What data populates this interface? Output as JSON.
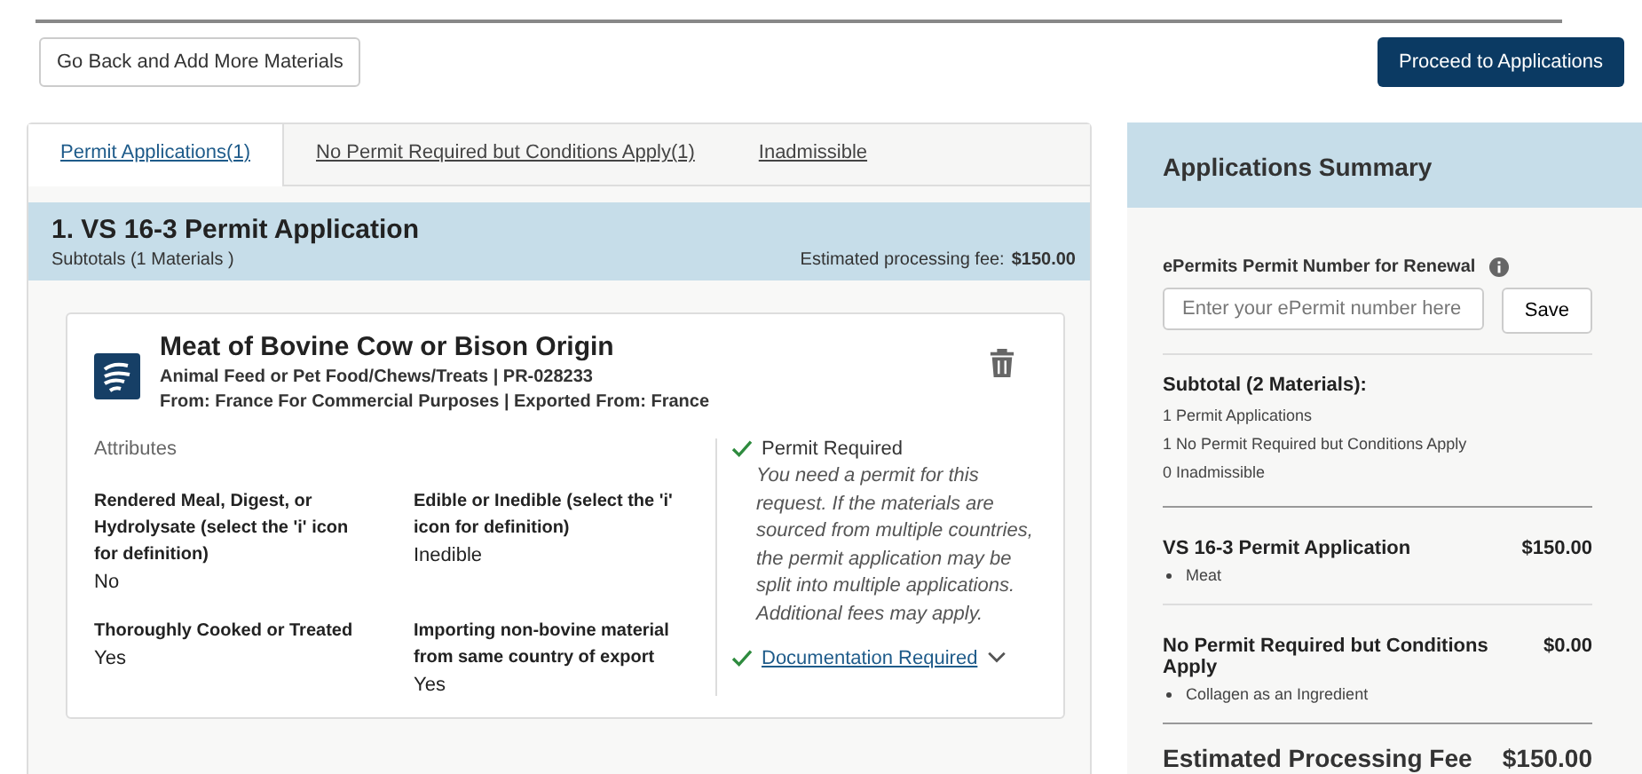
{
  "top_bar": {
    "back_button": "Go Back and Add More Materials",
    "proceed_button": "Proceed to Applications"
  },
  "tabs": [
    {
      "label": "Permit Applications(1)",
      "selected": true
    },
    {
      "label": "No Permit Required but Conditions Apply(1)",
      "selected": false
    },
    {
      "label": "Inadmissible",
      "selected": false
    }
  ],
  "application": {
    "title": "1. VS 16-3 Permit Application",
    "subtotals": "Subtotals (1 Materials )",
    "fee_label": "Estimated processing fee:",
    "fee": "$150.00"
  },
  "material": {
    "name": "Meat of Bovine Cow or Bison Origin",
    "category": "Animal Feed or Pet Food/Chews/Treats | PR-028233",
    "origin": "From: France For Commercial Purposes | Exported From: France",
    "attributes_heading": "Attributes",
    "attributes": [
      {
        "label": "Rendered Meal, Digest, or Hydrolysate (select the 'i' icon for definition)",
        "value": "No"
      },
      {
        "label": "Edible or Inedible (select the 'i' icon for definition)",
        "value": "Inedible"
      },
      {
        "label": "Thoroughly Cooked or Treated",
        "value": "Yes"
      },
      {
        "label": "Importing non-bovine material from same country of export",
        "value": "Yes"
      }
    ],
    "statuses": [
      {
        "kind": "note",
        "label": "Permit Required",
        "checked": true,
        "description": "You need a permit for this request. If the materials are sourced from multiple countries, the permit application may be split into multiple applications. Additional fees may apply."
      },
      {
        "kind": "link",
        "label": "Documentation Required",
        "checked": true,
        "expanded": false
      }
    ]
  },
  "summary": {
    "title": "Applications Summary",
    "renewal_label": "ePermits Permit Number for Renewal",
    "placeholder": "Enter your ePermit number here",
    "save_button": "Save",
    "subtotal_heading": "Subtotal (2 Materials):",
    "subtotal_lines": [
      "1 Permit Applications",
      "1 No Permit Required but Conditions Apply",
      "0 Inadmissible"
    ],
    "groups": [
      {
        "title": "VS 16-3 Permit Application",
        "amount": "$150.00",
        "items": [
          "Meat"
        ]
      },
      {
        "title": "No Permit Required but Conditions Apply",
        "amount": "$0.00",
        "items": [
          "Collagen as an Ingredient"
        ]
      }
    ],
    "total_label": "Estimated Processing Fee",
    "total": "$150.00"
  }
}
